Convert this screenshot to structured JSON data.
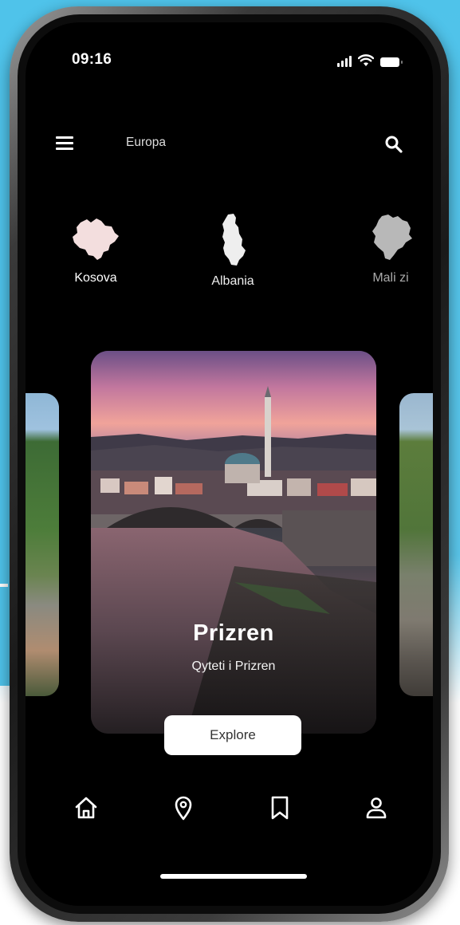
{
  "status_bar": {
    "time": "09:16"
  },
  "header": {
    "title": "Europa",
    "menu_icon": "hamburger-menu-icon",
    "search_icon": "search-icon"
  },
  "countries": [
    {
      "label": "Kosova",
      "icon": "kosovo-map-icon"
    },
    {
      "label": "Albania",
      "icon": "albania-map-icon"
    },
    {
      "label": "Mali zi",
      "icon": "montenegro-map-icon"
    }
  ],
  "featured": {
    "title": "Prizren",
    "subtitle": "Qyteti i Prizren",
    "button_label": "Explore"
  },
  "bottom_nav": [
    {
      "icon": "home-icon"
    },
    {
      "icon": "location-pin-icon"
    },
    {
      "icon": "bookmark-icon"
    },
    {
      "icon": "profile-icon"
    }
  ],
  "colors": {
    "background": "#4fc3ea",
    "screen": "#000000",
    "button": "#ffffff"
  }
}
